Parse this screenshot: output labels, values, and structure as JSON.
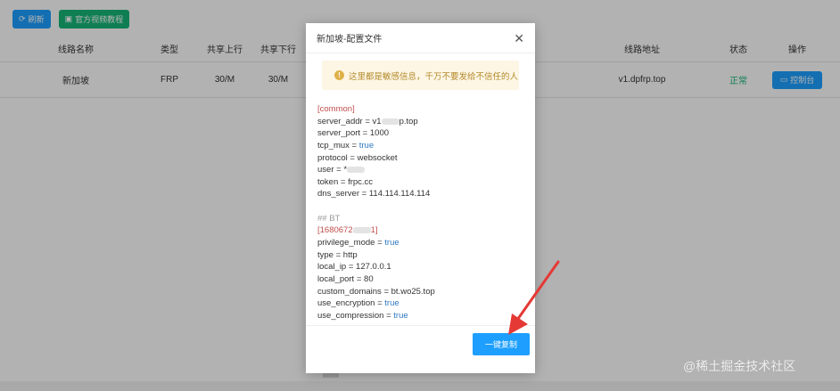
{
  "toolbar": {
    "refresh_label": "刷新",
    "video_label": "官方视频教程"
  },
  "table": {
    "headers": [
      "线路名称",
      "类型",
      "共享上行",
      "共享下行",
      "线路地址",
      "状态",
      "操作"
    ],
    "rows": [
      {
        "name": "新加坡",
        "type": "FRP",
        "up": "30/M",
        "down": "30/M",
        "address": "v1.dpfrp.top",
        "status": "正常",
        "action": "控制台"
      }
    ]
  },
  "modal": {
    "title": "新加坡-配置文件",
    "close": "✕",
    "warning": "这里都是敏感信息，千万不要发给不信任的人",
    "code_lines": [
      {
        "text": "[common]",
        "kind": "section"
      },
      {
        "key": "server_addr",
        "val_pre": "v1",
        "val_blur": true,
        "val_post": "p.top"
      },
      {
        "key": "server_port",
        "val_pre": "1000"
      },
      {
        "key": "tcp_mux",
        "val_pre": "true",
        "bool": true
      },
      {
        "key": "protocol",
        "val_pre": "websocket"
      },
      {
        "key": "user",
        "val_pre": "*",
        "val_blur": true
      },
      {
        "key": "token",
        "val_pre": "frpc.cc"
      },
      {
        "key": "dns_server",
        "val_pre": "114.114.114.114"
      },
      {
        "text": "",
        "kind": "blank"
      },
      {
        "text": "## BT",
        "kind": "comment"
      },
      {
        "text": "[1680672",
        "kind": "section",
        "blur": true,
        "post": "1]"
      },
      {
        "key": "privilege_mode",
        "val_pre": "true",
        "bool": true
      },
      {
        "key": "type",
        "val_pre": "http"
      },
      {
        "key": "local_ip",
        "val_pre": "127.0.0.1"
      },
      {
        "key": "local_port",
        "val_pre": "80"
      },
      {
        "key": "custom_domains",
        "val_pre": "bt.wo25.top"
      },
      {
        "key": "use_encryption",
        "val_pre": "true",
        "bool": true
      },
      {
        "key": "use_compression",
        "val_pre": "true",
        "bool": true
      }
    ],
    "copy_label": "一键复制"
  },
  "watermark": "@稀土掘金技术社区",
  "colors": {
    "primary": "#1e9fff",
    "success": "#16b777",
    "warning_bg": "#fdf6e4",
    "warning_text": "#b58a2c",
    "section": "#c0504d",
    "bool": "#2e78c2",
    "arrow": "#e53935"
  }
}
